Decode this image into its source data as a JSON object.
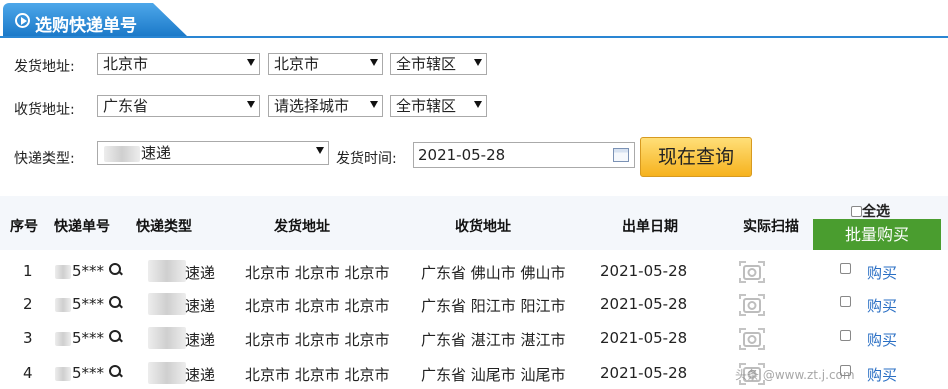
{
  "header": {
    "title": "选购快递单号"
  },
  "form": {
    "sender_label": "发货地址:",
    "sender": {
      "province": "北京市",
      "city": "北京市",
      "district": "全市辖区"
    },
    "receiver_label": "收货地址:",
    "receiver": {
      "province": "广东省",
      "city": "请选择城市",
      "district": "全市辖区"
    },
    "type_label": "快递类型:",
    "type_value": "速递",
    "date_label": "发货时间:",
    "date_value": "2021-05-28",
    "query_button": "现在查询"
  },
  "table": {
    "columns": [
      "序号",
      "快递单号",
      "快递类型",
      "发货地址",
      "收货地址",
      "出单日期",
      "实际扫描"
    ],
    "select_all": "全选",
    "bulk_buy": "批量购买",
    "rows": [
      {
        "index": "1",
        "tracking": "5***",
        "type": "速递",
        "from": "北京市 北京市 北京市",
        "to": "广东省 佛山市 佛山市",
        "date": "2021-05-28",
        "buy": "购买"
      },
      {
        "index": "2",
        "tracking": "5***",
        "type": "速递",
        "from": "北京市 北京市 北京市",
        "to": "广东省 阳江市 阳江市",
        "date": "2021-05-28",
        "buy": "购买"
      },
      {
        "index": "3",
        "tracking": "5***",
        "type": "速递",
        "from": "北京市 北京市 北京市",
        "to": "广东省 湛江市 湛江市",
        "date": "2021-05-28",
        "buy": "购买"
      },
      {
        "index": "4",
        "tracking": "5***",
        "type": "速递",
        "from": "北京市 北京市 北京市",
        "to": "广东省 汕尾市 汕尾市",
        "date": "2021-05-28",
        "buy": "购买"
      }
    ]
  },
  "watermark": "头条 @www.zt.j.com",
  "colors": {
    "accent": "#1a78c8",
    "query_button": "#f6b21e",
    "bulk_button": "#4a9d2f",
    "link": "#2a6fc4"
  }
}
